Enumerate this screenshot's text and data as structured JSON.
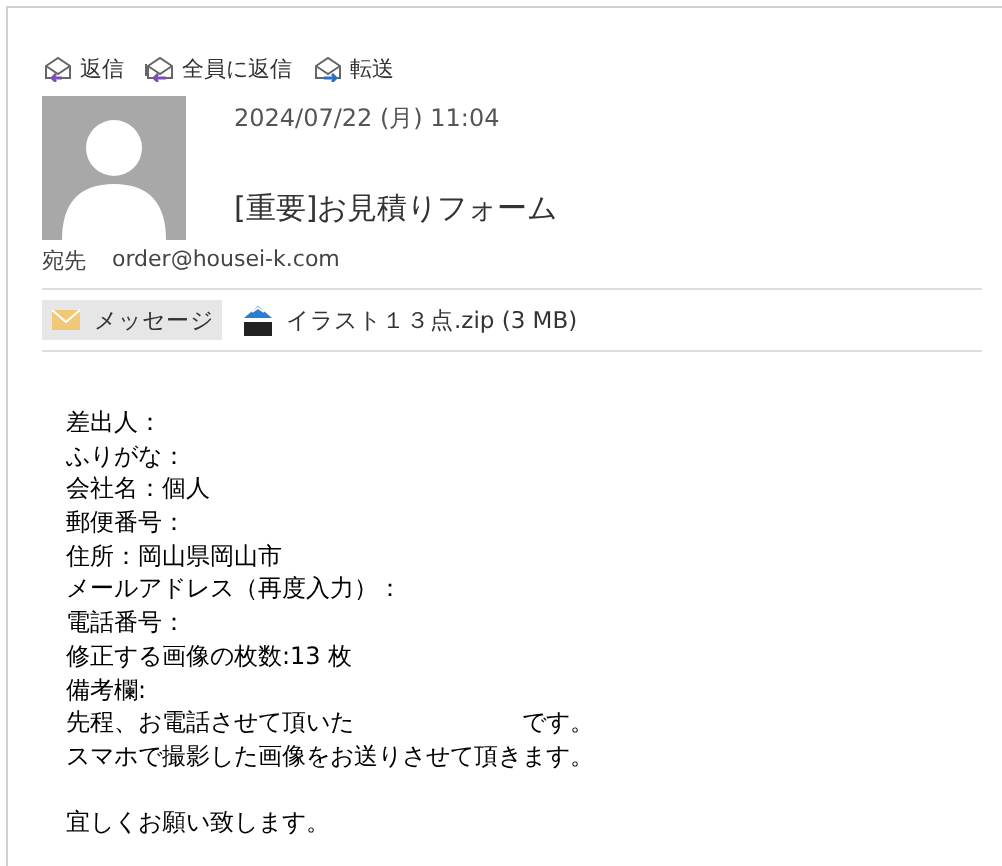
{
  "toolbar": [
    {
      "kind": "reply",
      "label": "返信"
    },
    {
      "kind": "reply_all",
      "label": "全員に返信"
    },
    {
      "kind": "forward",
      "label": "転送"
    }
  ],
  "message": {
    "date": "2024/07/22 (月) 11:04",
    "subject": "[重要]お見積りフォーム",
    "to_label": "宛先",
    "to": "order@housei-k.com"
  },
  "attachments": [
    {
      "kind": "message",
      "label": "メッセージ",
      "selected": true
    },
    {
      "kind": "zip",
      "label": "イラスト１３点.zip (3 MB)",
      "selected": false
    }
  ],
  "body": [
    [
      "差出人：",
      "ふりがな：",
      "会社名：個人",
      "郵便番号：",
      "住所：岡山県岡山市",
      "メールアドレス（再度入力）：",
      "電話番号：",
      "修正する画像の枚数:13 枚",
      "備考欄:",
      "先程、お電話させて頂いた　　　　　　　です。",
      "スマホで撮影した画像をお送りさせて頂きます。"
    ],
    [
      "宜しくお願い致します。"
    ]
  ]
}
